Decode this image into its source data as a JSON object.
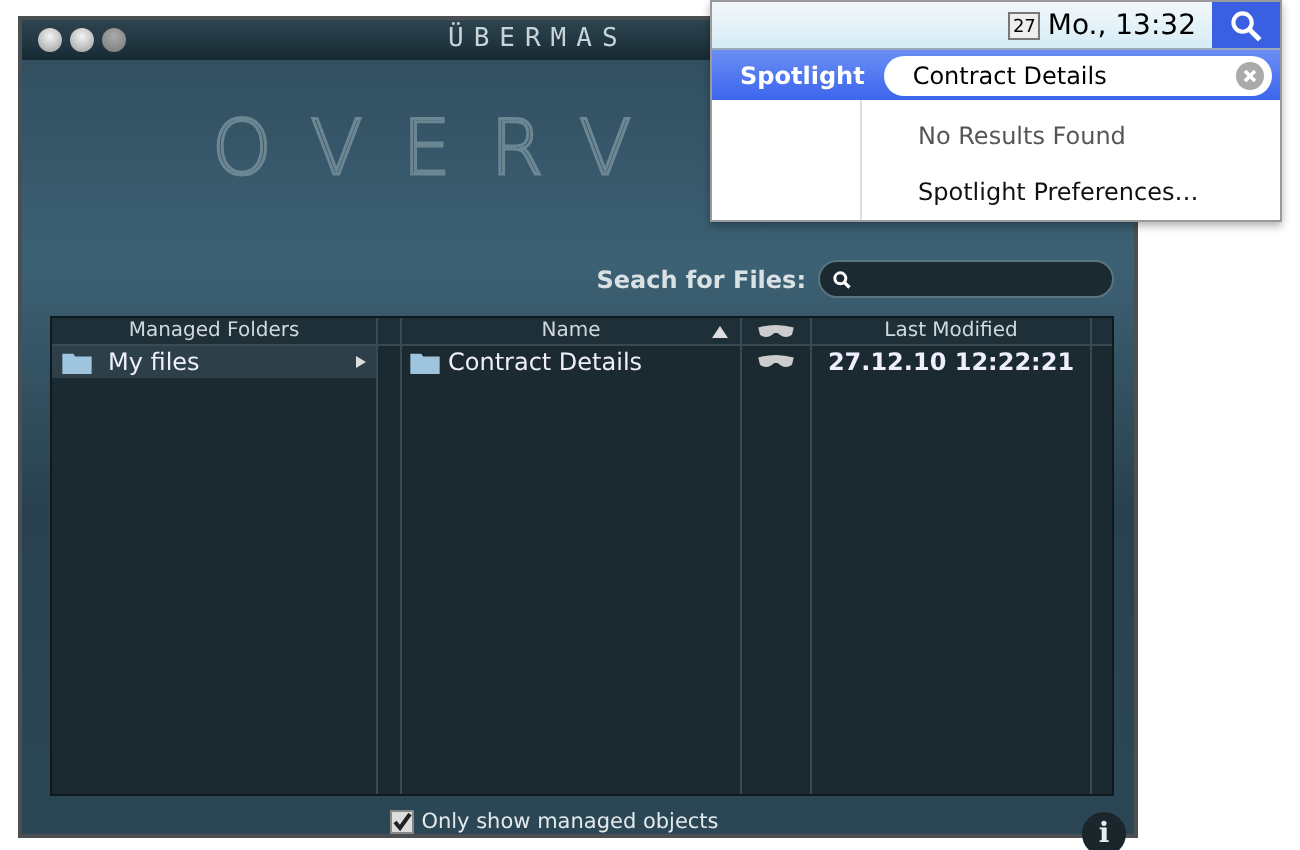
{
  "window": {
    "title": "ÜBERMAS",
    "banner": "OVERV"
  },
  "search": {
    "label": "Seach for Files:"
  },
  "folders": {
    "column": "Managed Folders",
    "items": [
      {
        "label": "My files",
        "selected": true
      }
    ]
  },
  "files": {
    "columns": [
      {
        "label": "Name",
        "sorted": true
      },
      {
        "kind": "mask"
      },
      {
        "label": "Last Modified"
      }
    ],
    "rows": [
      {
        "name": "Contract Details",
        "modified": "27.12.10 12:22:21"
      }
    ]
  },
  "only_managed": {
    "label": "Only show managed objects",
    "checked": true
  },
  "info_button": {
    "label": "i"
  },
  "menubar": {
    "calendar_day": "27",
    "clock": "Mo., 13:32"
  },
  "spotlight": {
    "label": "Spotlight",
    "query": "Contract Details",
    "results": [
      {
        "label": "No Results Found",
        "kind": "muted"
      },
      {
        "label": "Spotlight Preferences…",
        "kind": "item"
      }
    ]
  }
}
